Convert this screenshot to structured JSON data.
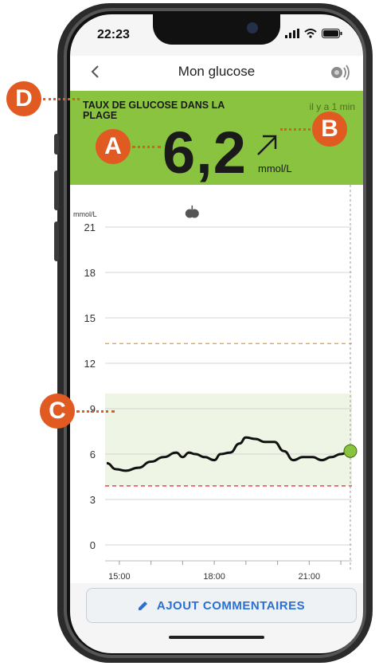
{
  "status": {
    "time": "22:23"
  },
  "header": {
    "title": "Mon glucose"
  },
  "banner": {
    "label": "TAUX DE GLUCOSE DANS LA PLAGE",
    "ago": "il y a 1 min",
    "value": "6,2",
    "unit": "mmol/L",
    "trend": "rising-slowly-arrow",
    "color": "#8ac33f"
  },
  "callouts": {
    "a": "A",
    "b": "B",
    "c": "C",
    "d": "D"
  },
  "chart_data": {
    "type": "line",
    "ylabel": "mmol/L",
    "yticks": [
      "21",
      "18",
      "15",
      "12",
      "9",
      "6",
      "3",
      "0"
    ],
    "ylim": [
      0,
      21
    ],
    "xticks": [
      "15:00",
      "18:00",
      "21:00"
    ],
    "target_range": [
      3.9,
      10.0
    ],
    "high_threshold": 13.3,
    "low_threshold": 3.9,
    "event_marker": {
      "icon": "apple-icon",
      "time": 17.3
    },
    "series": [
      {
        "x": [
          14.6,
          14.9,
          15.2,
          15.6,
          16.0,
          16.4,
          16.8,
          17.0,
          17.2,
          17.4,
          17.7,
          18.0,
          18.2,
          18.5,
          18.8,
          19.0,
          19.3,
          19.6,
          19.9,
          20.2,
          20.5,
          20.8,
          21.1,
          21.4,
          21.7,
          22.0,
          22.3
        ],
        "y": [
          5.4,
          5.0,
          4.9,
          5.1,
          5.5,
          5.8,
          6.1,
          5.8,
          6.1,
          6.0,
          5.8,
          5.6,
          6.0,
          6.1,
          6.7,
          7.1,
          7.0,
          6.8,
          6.8,
          6.2,
          5.6,
          5.8,
          5.8,
          5.6,
          5.8,
          6.0,
          6.2
        ]
      }
    ]
  },
  "actions": {
    "comment_label": "AJOUT COMMENTAIRES"
  }
}
